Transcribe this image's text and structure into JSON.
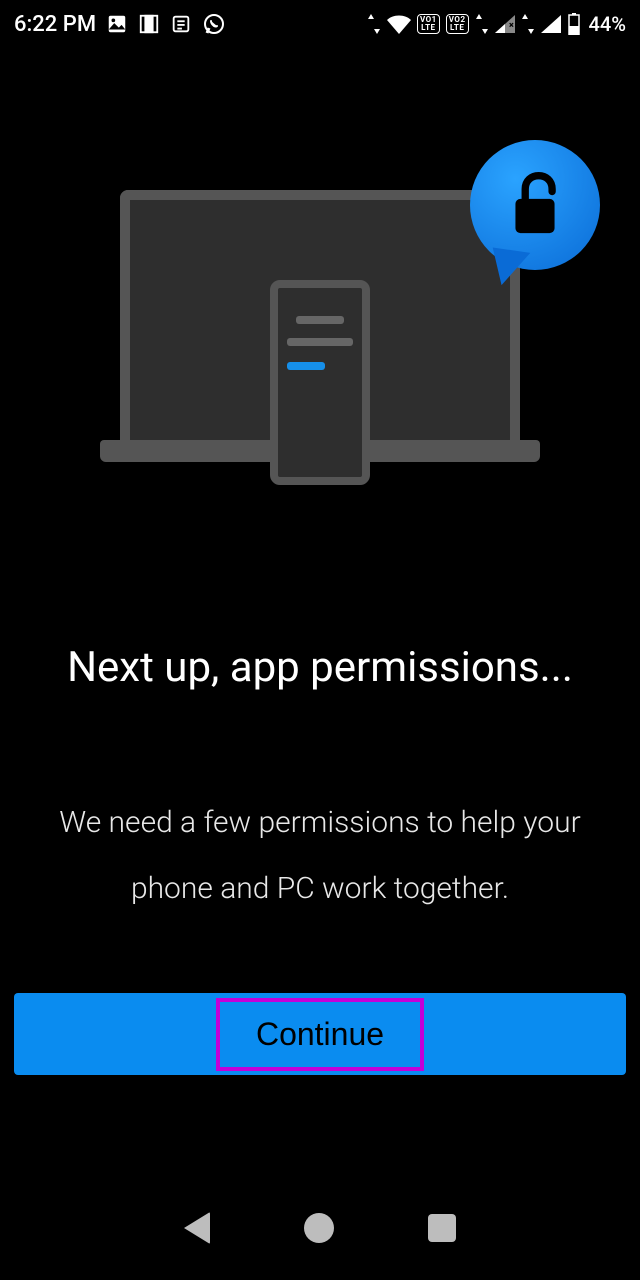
{
  "status": {
    "time": "6:22 PM",
    "battery": "44%",
    "lte1_top": "VO1",
    "lte1_bot": "LTE",
    "lte2_top": "VO2",
    "lte2_bot": "LTE"
  },
  "screen": {
    "title": "Next up, app permissions...",
    "subtitle": "We need a few permissions to help your phone and PC work together.",
    "continue_label": "Continue"
  }
}
